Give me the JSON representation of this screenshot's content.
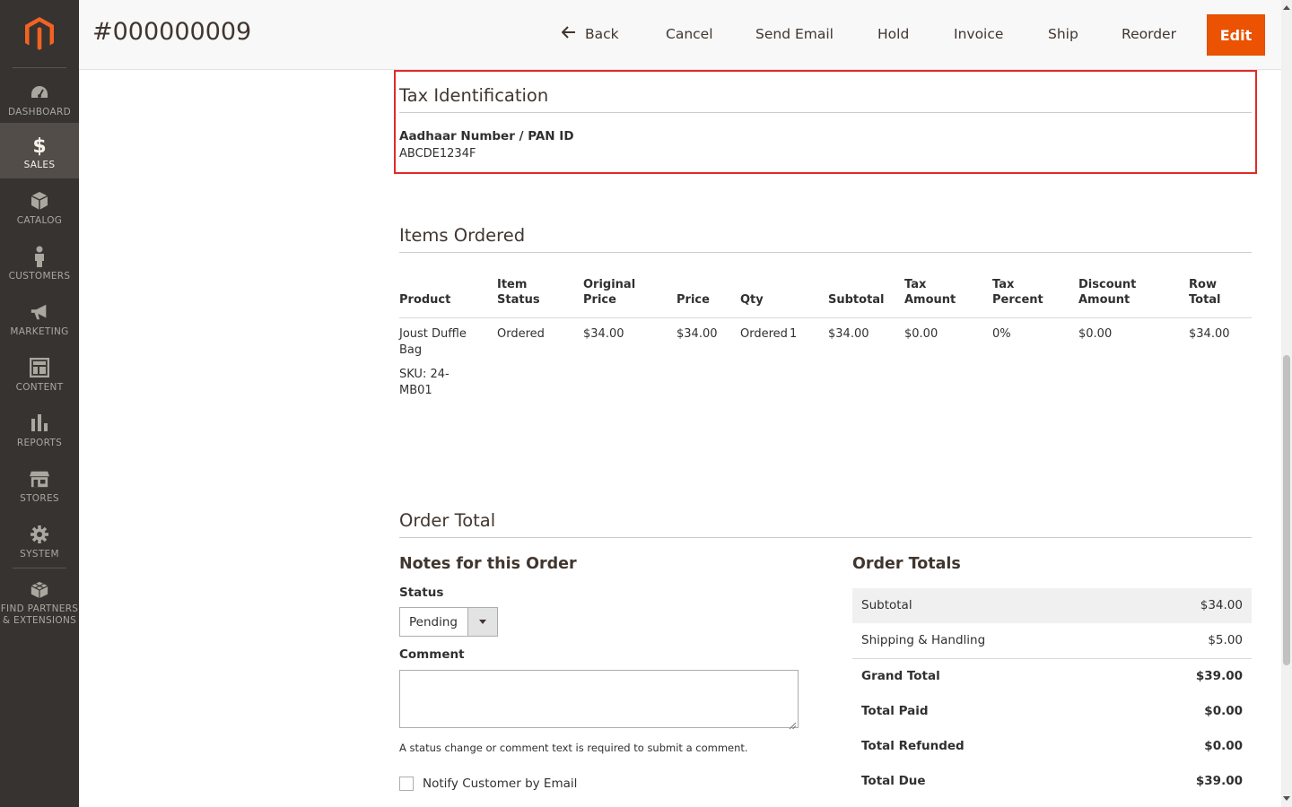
{
  "colors": {
    "sidebar_bg": "#373330",
    "sidebar_active": "#524d49",
    "accent": "#eb5202",
    "highlight_border": "#e02b27"
  },
  "sidebar": {
    "logo": "magento-logo-icon",
    "items": [
      {
        "label": "DASHBOARD",
        "icon": "speedometer-icon",
        "active": false
      },
      {
        "label": "SALES",
        "icon": "dollar-icon",
        "active": true
      },
      {
        "label": "CATALOG",
        "icon": "box-icon",
        "active": false
      },
      {
        "label": "CUSTOMERS",
        "icon": "person-icon",
        "active": false
      },
      {
        "label": "MARKETING",
        "icon": "megaphone-icon",
        "active": false
      },
      {
        "label": "CONTENT",
        "icon": "layout-icon",
        "active": false
      },
      {
        "label": "REPORTS",
        "icon": "bar-chart-icon",
        "active": false
      },
      {
        "label": "STORES",
        "icon": "storefront-icon",
        "active": false
      },
      {
        "label": "SYSTEM",
        "icon": "gear-icon",
        "active": false
      },
      {
        "label_line1": "FIND PARTNERS",
        "label_line2": "& EXTENSIONS",
        "icon": "cubes-icon",
        "active": false
      }
    ]
  },
  "header": {
    "title": "#000000009",
    "buttons": {
      "back": "Back",
      "cancel": "Cancel",
      "send_email": "Send Email",
      "hold": "Hold",
      "invoice": "Invoice",
      "ship": "Ship",
      "reorder": "Reorder",
      "edit": "Edit"
    }
  },
  "tax": {
    "title": "Tax Identification",
    "label": "Aadhaar Number / PAN ID",
    "value": "ABCDE1234F"
  },
  "items": {
    "title": "Items Ordered",
    "headers": {
      "product": "Product",
      "item_status_1": "Item",
      "item_status_2": "Status",
      "original_price_1": "Original",
      "original_price_2": "Price",
      "price": "Price",
      "qty": "Qty",
      "subtotal": "Subtotal",
      "tax_amount_1": "Tax",
      "tax_amount_2": "Amount",
      "tax_percent_1": "Tax",
      "tax_percent_2": "Percent",
      "discount_1": "Discount",
      "discount_2": "Amount",
      "row_total_1": "Row",
      "row_total_2": "Total"
    },
    "rows": [
      {
        "product_line1": "Joust Duffle",
        "product_line2": "Bag",
        "sku_line1": "SKU: 24-",
        "sku_line2": "MB01",
        "status": "Ordered",
        "original_price": "$34.00",
        "price": "$34.00",
        "qty_label": "Ordered",
        "qty_value": "1",
        "subtotal": "$34.00",
        "tax_amount": "$0.00",
        "tax_percent": "0%",
        "discount": "$0.00",
        "row_total": "$34.00"
      }
    ]
  },
  "order_total": {
    "title": "Order Total",
    "notes": {
      "title": "Notes for this Order",
      "status_label": "Status",
      "status_value": "Pending",
      "comment_label": "Comment",
      "comment_value": "",
      "hint": "A status change or comment text is required to submit a comment.",
      "notify_label": "Notify Customer by Email",
      "notify_checked": false
    },
    "totals": {
      "title": "Order Totals",
      "rows": [
        {
          "label": "Subtotal",
          "value": "$34.00",
          "bold": false
        },
        {
          "label": "Shipping & Handling",
          "value": "$5.00",
          "bold": false
        },
        {
          "label": "Grand Total",
          "value": "$39.00",
          "bold": true
        },
        {
          "label": "Total Paid",
          "value": "$0.00",
          "bold": true
        },
        {
          "label": "Total Refunded",
          "value": "$0.00",
          "bold": true
        },
        {
          "label": "Total Due",
          "value": "$39.00",
          "bold": true
        }
      ]
    }
  }
}
